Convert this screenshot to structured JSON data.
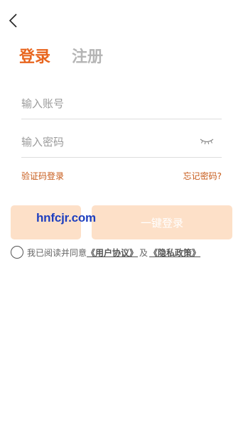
{
  "tabs": {
    "login": "登录",
    "register": "注册"
  },
  "form": {
    "account_placeholder": "输入账号",
    "password_placeholder": "输入密码"
  },
  "links": {
    "sms_login": "验证码登录",
    "forgot_password": "忘记密码?"
  },
  "buttons": {
    "one_click_login": "一键登录"
  },
  "watermark": "hnfcjr.com",
  "agreement": {
    "prefix": "我已阅读并同意",
    "user_agreement": "《用户协议》",
    "and": "及",
    "privacy_policy": "《隐私政策》"
  },
  "colors": {
    "accent": "#e8651e",
    "button_bg": "#fde0c8",
    "link": "#c75a19"
  },
  "icons": {
    "back": "chevron-left-icon",
    "password_visibility": "eye-closed-icon"
  }
}
